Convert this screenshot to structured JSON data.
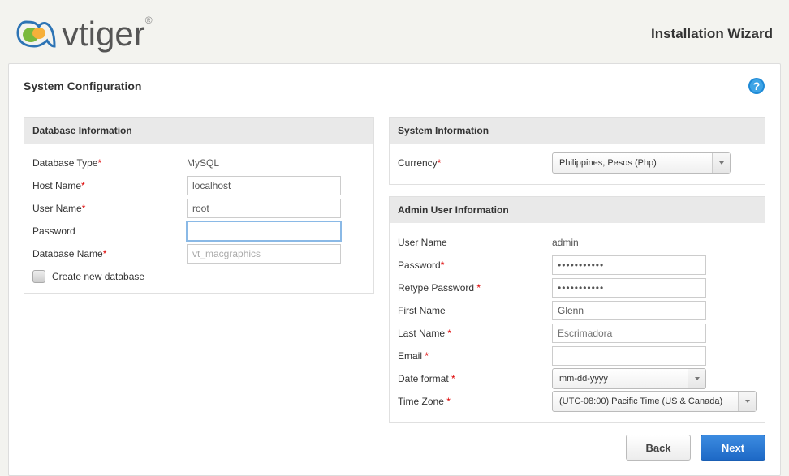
{
  "header": {
    "brand": "vtiger",
    "wizard_title": "Installation Wizard"
  },
  "page": {
    "title": "System Configuration"
  },
  "db": {
    "section_title": "Database Information",
    "type_label": "Database Type",
    "type_value": "MySQL",
    "host_label": "Host Name",
    "host_value": "localhost",
    "user_label": "User Name",
    "user_value": "root",
    "password_label": "Password",
    "password_value": "",
    "name_label": "Database Name",
    "name_value": "vt_macgraphics",
    "create_label": "Create new database"
  },
  "system": {
    "section_title": "System Information",
    "currency_label": "Currency",
    "currency_value": "Philippines, Pesos (Php)"
  },
  "admin": {
    "section_title": "Admin User Information",
    "username_label": "User Name",
    "username_value": "admin",
    "password_label": "Password",
    "password_display": "•••••••••••",
    "retype_label": "Retype Password",
    "retype_display": "•••••••••••",
    "firstname_label": "First Name",
    "firstname_value": "Glenn",
    "lastname_label": "Last Name",
    "lastname_placeholder": "Escrimadora",
    "email_label": "Email",
    "email_value": "",
    "dateformat_label": "Date format",
    "dateformat_value": "mm-dd-yyyy",
    "timezone_label": "Time Zone",
    "timezone_value": "(UTC-08:00) Pacific Time (US & Canada)"
  },
  "buttons": {
    "back": "Back",
    "next": "Next"
  }
}
